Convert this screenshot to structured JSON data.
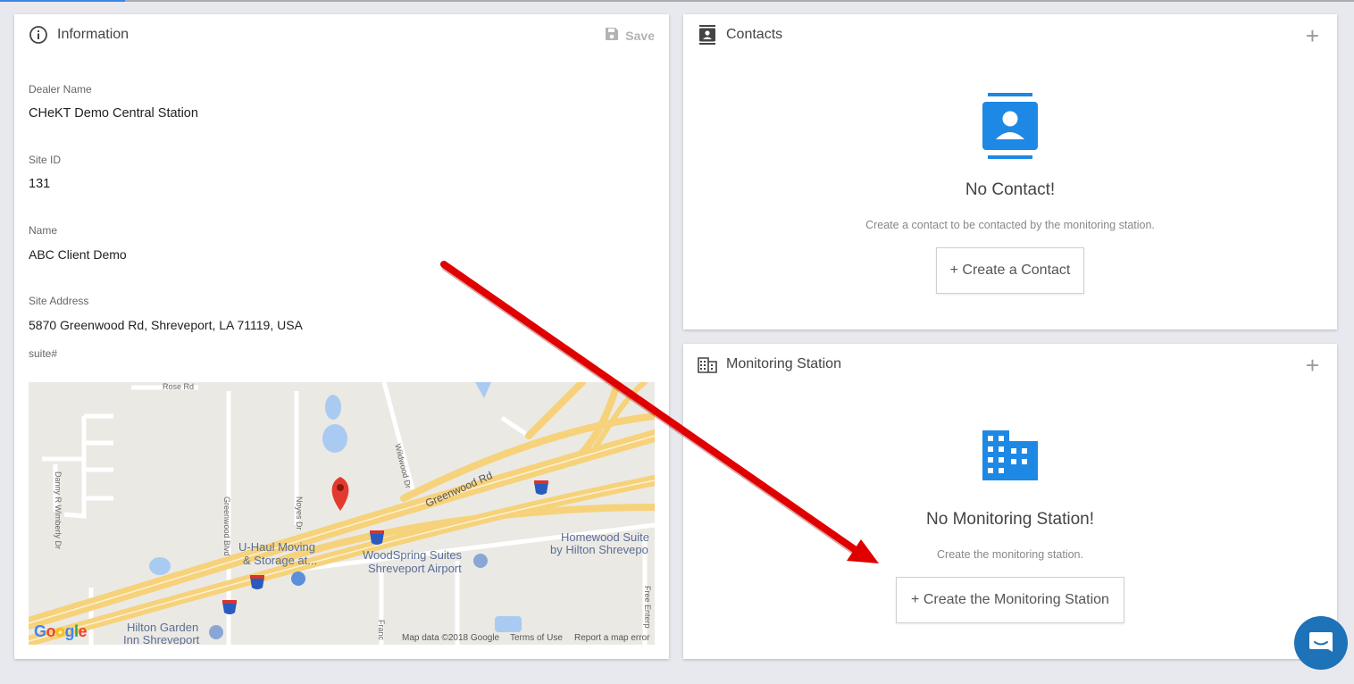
{
  "colors": {
    "accent_blue": "#1e88e5",
    "arrow_red": "#e00000",
    "chat_blue": "#1e72b8"
  },
  "information": {
    "title": "Information",
    "title_icon": "info-circle-icon",
    "save_label": "Save",
    "save_icon": "floppy-disk-icon",
    "fields": [
      {
        "label": "Dealer Name",
        "value": "CHeKT Demo Central Station"
      },
      {
        "label": "Site ID",
        "value": "131"
      },
      {
        "label": "Name",
        "value": "ABC Client Demo"
      },
      {
        "label": "Site Address",
        "value": "5870 Greenwood Rd, Shreveport, LA 71119, USA"
      }
    ],
    "suite_label": "suite#",
    "map": {
      "labels": {
        "rose_rd": "Rose Rd",
        "danny": "Danny R Wimberly Dr",
        "greenwood_blvd": "Greenwood Blvd",
        "noyes": "Noyes Dr",
        "wildwood": "Wildwood Dr",
        "greenwood_rd": "Greenwood Rd",
        "uhaul_1": "U-Haul Moving",
        "uhaul_2": "& Storage at...",
        "woodspring_1": "WoodSpring Suites",
        "woodspring_2": "Shreveport Airport",
        "homewood_1": "Homewood Suite",
        "homewood_2": "by Hilton Shrevepo",
        "hilton_1": "Hilton Garden",
        "hilton_2": "Inn Shreveport",
        "francis": "Franc",
        "free_ent": "Free Enterp",
        "interstate": "20"
      },
      "google": "Google",
      "footer_data": "Map data ©2018 Google",
      "footer_terms": "Terms of Use",
      "footer_report": "Report a map error"
    }
  },
  "contacts": {
    "title": "Contacts",
    "title_icon": "contact-book-icon",
    "empty_icon": "contact-card-icon",
    "empty_title": "No Contact!",
    "empty_sub": "Create a contact to be contacted by the monitoring station.",
    "button": "+ Create a Contact",
    "add_symbol": "+"
  },
  "monitoring": {
    "title": "Monitoring Station",
    "title_icon": "building-icon",
    "empty_icon": "building-icon",
    "empty_title": "No Monitoring Station!",
    "empty_sub": "Create the monitoring station.",
    "button": "+ Create the Monitoring Station",
    "add_symbol": "+"
  },
  "chat": {
    "icon": "chat-bubble-icon"
  }
}
